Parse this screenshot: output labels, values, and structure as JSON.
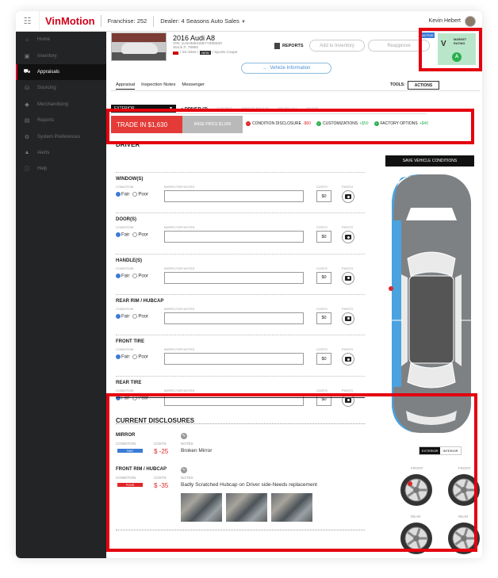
{
  "app": {
    "logo": "VinMotion",
    "franchise": "Franchise: 252",
    "dealer": "Dealer: 4 Seasons Auto Sales",
    "user_name": "Kevin Hebert"
  },
  "sidebar": {
    "items": [
      {
        "label": "Home",
        "icon": "home-icon"
      },
      {
        "label": "Inventory",
        "icon": "inventory-icon"
      },
      {
        "label": "Appraisals",
        "icon": "car-icon",
        "active": true
      },
      {
        "label": "Sourcing",
        "icon": "sourcing-icon"
      },
      {
        "label": "Merchandising",
        "icon": "tag-icon"
      },
      {
        "label": "Reports",
        "icon": "report-icon"
      },
      {
        "label": "System Preferences",
        "icon": "gear-icon"
      },
      {
        "label": "Alerts",
        "icon": "bell-icon"
      },
      {
        "label": "Help",
        "icon": "help-icon"
      }
    ]
  },
  "vehicle": {
    "title": "2016 Audi A8",
    "vin": "VIN: 1LNHM81W8YY836530",
    "stock": "Stock #: 78950",
    "miles": "/ 25 miles /",
    "new_badge": "NEW",
    "body": "/ Sports Coupe",
    "status": "ACTIVE"
  },
  "header": {
    "reports": "REPORTS",
    "add_inventory": "Add to Inventory",
    "reapprove": "Reapprove",
    "vehicle_info": "Vehicle Information"
  },
  "market": {
    "label": "MARKET RATING",
    "grade": "A"
  },
  "tabs": {
    "items": [
      "Appraisal",
      "Inspection Notes",
      "Messenger"
    ],
    "tools_label": "TOOLS:",
    "actions": "ACTIONS"
  },
  "section": {
    "select": "EXTERIOR",
    "tabs": [
      "DRIVER (3)",
      "FRONT",
      "PASSENGER",
      "REAR (1)",
      "ROOF"
    ],
    "trade_in": "TRADE IN $1,630",
    "base_price": "BASE PRICE $1,600",
    "summary": [
      {
        "label": "CONDITION DISCLOSURE",
        "value": "-$60",
        "tone": "neg"
      },
      {
        "label": "CUSTOMIZATIONS",
        "value": "+$50",
        "tone": "pos"
      },
      {
        "label": "FACTORY OPTIONS",
        "value": "+$40",
        "tone": "pos"
      }
    ]
  },
  "driver": {
    "title": "DRIVER",
    "save_label": "SAVE VEHICLE CONDITIONS",
    "labels": {
      "condition": "CONDITION",
      "notes": "INSPECTOR NOTES",
      "costs": "COSTS",
      "photo": "PHOTO",
      "fair": "Fair",
      "poor": "Poor"
    },
    "items": [
      {
        "title": "WINDOW(S)",
        "cost": "$0"
      },
      {
        "title": "DOOR(S)",
        "cost": "$0"
      },
      {
        "title": "HANDLE(S)",
        "cost": "$0"
      },
      {
        "title": "REAR RIM / HUBCAP",
        "cost": "$0"
      },
      {
        "title": "FRONT TIRE",
        "cost": "$0"
      },
      {
        "title": "REAR TIRE",
        "cost": "$0"
      }
    ]
  },
  "disclosures": {
    "title": "CURRENT DISCLOSURES",
    "labels": {
      "condition": "CONDITION",
      "costs": "COSTS",
      "notes": "NOTES"
    },
    "items": [
      {
        "title": "MIRROR",
        "condition": "FAIR",
        "condition_color": "#3a7bd5",
        "cost": "$ -25",
        "note": "Broken Mirror"
      },
      {
        "title": "FRONT RIM / HUBCAP",
        "condition": "POOR",
        "condition_color": "#e0262a",
        "cost": "$ -35",
        "note": "Badly Scratched Hubcap on Driver side-Needs replacement"
      }
    ]
  },
  "view_toggle": {
    "exterior": "EXTERIOR",
    "interior": "INTERIOR"
  },
  "tires": {
    "labels": [
      "FRONT",
      "FRONT",
      "REAR",
      "REAR"
    ]
  },
  "colors": {
    "brand": "#d0021b",
    "trade": "#e43b39",
    "accent": "#3a7bd5",
    "positive": "#2ab04f",
    "market": "#b9e6c9",
    "highlight": "#e4000f"
  }
}
